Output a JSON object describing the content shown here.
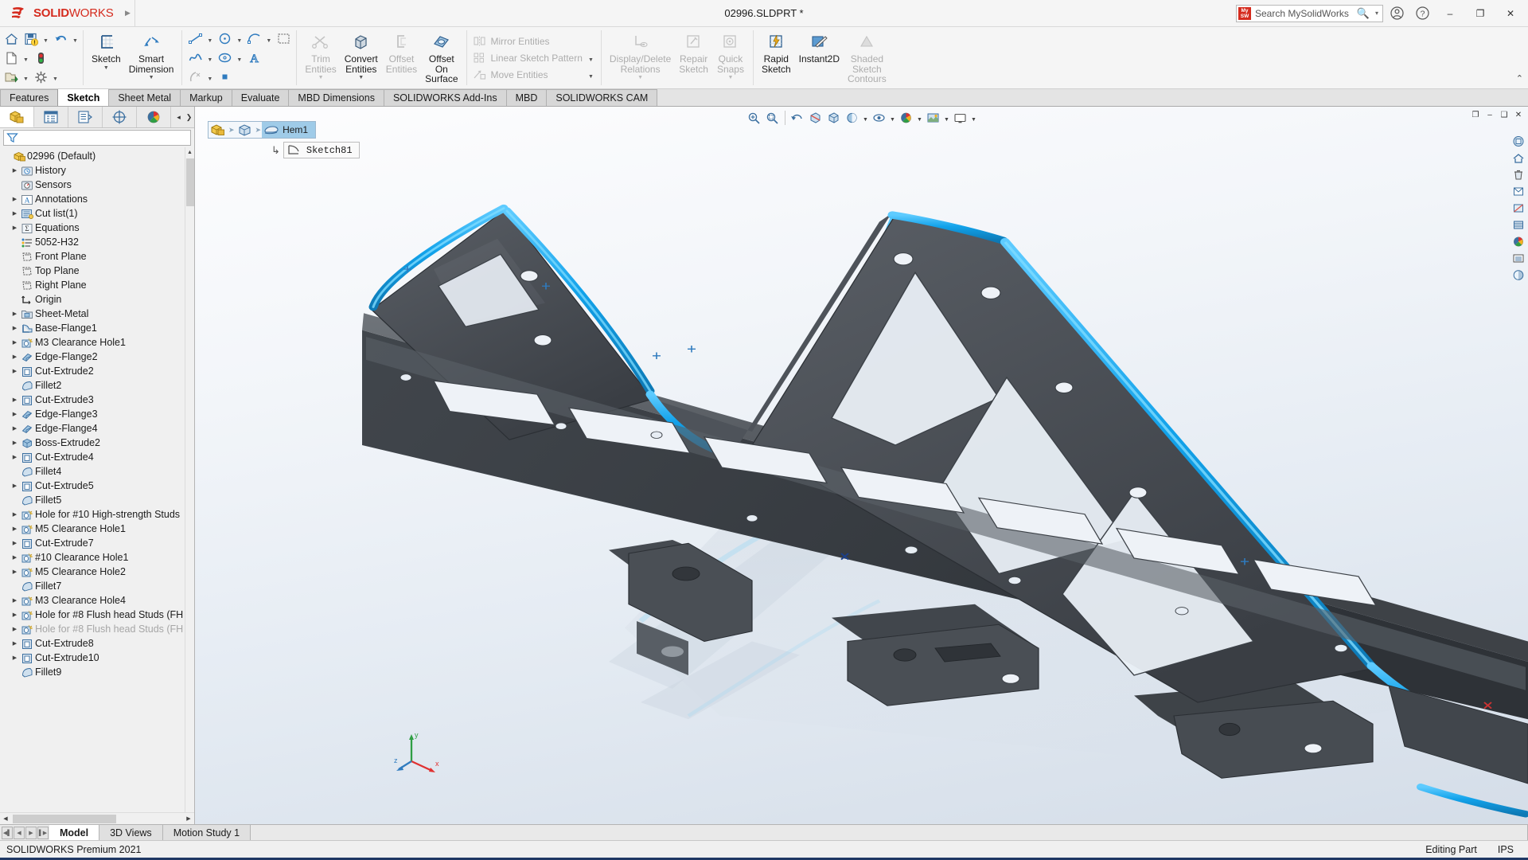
{
  "app": {
    "brand_bold": "SOLID",
    "brand_light": "WORKS",
    "title": "02996.SLDPRT *",
    "status_left": "SOLIDWORKS Premium 2021",
    "status_editing": "Editing Part",
    "status_units": "IPS",
    "accent_red": "#d52b1e",
    "accent_blue": "#2f7bbf",
    "highlight_cyan": "#1ba4e8"
  },
  "search": {
    "placeholder": "Search MySolidWorks",
    "icon": "search-icon",
    "badge_top": "My",
    "badge_bottom": "SW",
    "caret": "▾"
  },
  "titlebar_buttons": {
    "account": "account-icon",
    "help": "help-icon",
    "minimize": "–",
    "restore": "❐",
    "close": "✕"
  },
  "quick_access": {
    "home": "home-icon",
    "save": "save-icon",
    "undo": "undo-icon",
    "new": "new-document-icon",
    "rebuild": "rebuild-traffic-light-icon",
    "open": "open-folder-icon",
    "options": "options-gear-icon"
  },
  "ribbon": {
    "groups": [
      {
        "name": "sketch-group",
        "big": [
          {
            "label": "Sketch",
            "icon": "sketch-icon",
            "enabled": true,
            "caret": true
          },
          {
            "label": "Smart\nDimension",
            "icon": "smart-dimension-icon",
            "enabled": true,
            "caret": true
          }
        ]
      },
      {
        "name": "entities-group",
        "small_rows": [
          [
            "line-icon",
            "circle-icon",
            "arc-icon",
            "rectangle-grid-icon"
          ],
          [
            "spline-icon",
            "ellipse-icon",
            "text-icon"
          ],
          [
            "arc3pt-icon",
            "point-icon"
          ]
        ]
      },
      {
        "name": "tools-group",
        "big": [
          {
            "label": "Trim\nEntities",
            "icon": "trim-entities-icon",
            "enabled": false,
            "caret": true
          },
          {
            "label": "Convert\nEntities",
            "icon": "convert-entities-icon",
            "enabled": true,
            "caret": true
          },
          {
            "label": "Offset\nEntities",
            "icon": "offset-entities-icon",
            "enabled": false,
            "caret": false
          },
          {
            "label": "Offset\nOn\nSurface",
            "icon": "offset-on-surface-icon",
            "enabled": true,
            "caret": false
          }
        ]
      },
      {
        "name": "pattern-group",
        "stacked": [
          {
            "label": "Mirror Entities",
            "icon": "mirror-entities-icon",
            "enabled": false,
            "caret": false
          },
          {
            "label": "Linear Sketch Pattern",
            "icon": "linear-sketch-pattern-icon",
            "enabled": false,
            "caret": true
          },
          {
            "label": "Move Entities",
            "icon": "move-entities-icon",
            "enabled": false,
            "caret": true
          }
        ]
      },
      {
        "name": "relations-group",
        "big": [
          {
            "label": "Display/Delete\nRelations",
            "icon": "display-delete-relations-icon",
            "enabled": false,
            "caret": true
          },
          {
            "label": "Repair\nSketch",
            "icon": "repair-sketch-icon",
            "enabled": false,
            "caret": false
          },
          {
            "label": "Quick\nSnaps",
            "icon": "quick-snaps-icon",
            "enabled": false,
            "caret": true
          }
        ]
      },
      {
        "name": "modes-group",
        "big": [
          {
            "label": "Rapid\nSketch",
            "icon": "rapid-sketch-icon",
            "enabled": true,
            "caret": false
          },
          {
            "label": "Instant2D",
            "icon": "instant2d-icon",
            "enabled": true,
            "caret": false
          },
          {
            "label": "Shaded\nSketch\nContours",
            "icon": "shaded-sketch-contours-icon",
            "enabled": false,
            "caret": false
          }
        ]
      }
    ],
    "pin": "⌃"
  },
  "command_tabs": {
    "items": [
      {
        "label": "Features",
        "active": false
      },
      {
        "label": "Sketch",
        "active": true
      },
      {
        "label": "Sheet Metal",
        "active": false
      },
      {
        "label": "Markup",
        "active": false
      },
      {
        "label": "Evaluate",
        "active": false
      },
      {
        "label": "MBD Dimensions",
        "active": false
      },
      {
        "label": "SOLIDWORKS Add-Ins",
        "active": false
      },
      {
        "label": "MBD",
        "active": false
      },
      {
        "label": "SOLIDWORKS CAM",
        "active": false
      }
    ]
  },
  "feature_manager": {
    "tabs": [
      {
        "name": "feature-manager-tab",
        "icon": "feature-tree-icon",
        "active": true
      },
      {
        "name": "property-manager-tab",
        "icon": "property-manager-icon",
        "active": false
      },
      {
        "name": "configuration-manager-tab",
        "icon": "configuration-manager-icon",
        "active": false
      },
      {
        "name": "dimxpert-manager-tab",
        "icon": "dimxpert-icon",
        "active": false
      },
      {
        "name": "display-manager-tab",
        "icon": "display-manager-icon",
        "active": false
      }
    ],
    "filter_placeholder": "",
    "filter_icon": "filter-funnel-icon",
    "scroll_left": "◂",
    "scroll_right": "❯",
    "tree": [
      {
        "label": "02996  (Default)",
        "icon": "part-icon",
        "indent": 0,
        "expand": "none",
        "dim": false
      },
      {
        "label": "History",
        "icon": "history-icon",
        "indent": 1,
        "expand": "collapsed",
        "dim": false
      },
      {
        "label": "Sensors",
        "icon": "sensors-icon",
        "indent": 1,
        "expand": "none",
        "dim": false
      },
      {
        "label": "Annotations",
        "icon": "annotations-icon",
        "indent": 1,
        "expand": "collapsed",
        "dim": false
      },
      {
        "label": "Cut list(1)",
        "icon": "cutlist-icon",
        "indent": 1,
        "expand": "collapsed",
        "dim": false
      },
      {
        "label": "Equations",
        "icon": "equations-icon",
        "indent": 1,
        "expand": "collapsed",
        "dim": false
      },
      {
        "label": "5052-H32",
        "icon": "material-icon",
        "indent": 1,
        "expand": "none",
        "dim": false
      },
      {
        "label": "Front Plane",
        "icon": "plane-icon",
        "indent": 1,
        "expand": "none",
        "dim": false
      },
      {
        "label": "Top Plane",
        "icon": "plane-icon",
        "indent": 1,
        "expand": "none",
        "dim": false
      },
      {
        "label": "Right Plane",
        "icon": "plane-icon",
        "indent": 1,
        "expand": "none",
        "dim": false
      },
      {
        "label": "Origin",
        "icon": "origin-icon",
        "indent": 1,
        "expand": "none",
        "dim": false
      },
      {
        "label": "Sheet-Metal",
        "icon": "sheetmetal-folder-icon",
        "indent": 1,
        "expand": "collapsed",
        "dim": false
      },
      {
        "label": "Base-Flange1",
        "icon": "base-flange-icon",
        "indent": 1,
        "expand": "collapsed",
        "dim": false
      },
      {
        "label": "M3 Clearance Hole1",
        "icon": "hole-wizard-icon",
        "indent": 1,
        "expand": "collapsed",
        "dim": false
      },
      {
        "label": "Edge-Flange2",
        "icon": "edge-flange-icon",
        "indent": 1,
        "expand": "collapsed",
        "dim": false
      },
      {
        "label": "Cut-Extrude2",
        "icon": "cut-extrude-icon",
        "indent": 1,
        "expand": "collapsed",
        "dim": false
      },
      {
        "label": "Fillet2",
        "icon": "fillet-icon",
        "indent": 1,
        "expand": "none",
        "dim": false
      },
      {
        "label": "Cut-Extrude3",
        "icon": "cut-extrude-icon",
        "indent": 1,
        "expand": "collapsed",
        "dim": false
      },
      {
        "label": "Edge-Flange3",
        "icon": "edge-flange-icon",
        "indent": 1,
        "expand": "collapsed",
        "dim": false
      },
      {
        "label": "Edge-Flange4",
        "icon": "edge-flange-icon",
        "indent": 1,
        "expand": "collapsed",
        "dim": false
      },
      {
        "label": "Boss-Extrude2",
        "icon": "boss-extrude-icon",
        "indent": 1,
        "expand": "collapsed",
        "dim": false
      },
      {
        "label": "Cut-Extrude4",
        "icon": "cut-extrude-icon",
        "indent": 1,
        "expand": "collapsed",
        "dim": false
      },
      {
        "label": "Fillet4",
        "icon": "fillet-icon",
        "indent": 1,
        "expand": "none",
        "dim": false
      },
      {
        "label": "Cut-Extrude5",
        "icon": "cut-extrude-icon",
        "indent": 1,
        "expand": "collapsed",
        "dim": false
      },
      {
        "label": "Fillet5",
        "icon": "fillet-icon",
        "indent": 1,
        "expand": "none",
        "dim": false
      },
      {
        "label": "Hole for #10 High-strength Studs",
        "icon": "hole-wizard-icon",
        "indent": 1,
        "expand": "collapsed",
        "dim": false
      },
      {
        "label": "M5 Clearance Hole1",
        "icon": "hole-wizard-icon",
        "indent": 1,
        "expand": "collapsed",
        "dim": false
      },
      {
        "label": "Cut-Extrude7",
        "icon": "cut-extrude-icon",
        "indent": 1,
        "expand": "collapsed",
        "dim": false
      },
      {
        "label": "#10 Clearance Hole1",
        "icon": "hole-wizard-icon",
        "indent": 1,
        "expand": "collapsed",
        "dim": false
      },
      {
        "label": "M5 Clearance Hole2",
        "icon": "hole-wizard-icon",
        "indent": 1,
        "expand": "collapsed",
        "dim": false
      },
      {
        "label": "Fillet7",
        "icon": "fillet-icon",
        "indent": 1,
        "expand": "none",
        "dim": false
      },
      {
        "label": "M3 Clearance Hole4",
        "icon": "hole-wizard-icon",
        "indent": 1,
        "expand": "collapsed",
        "dim": false
      },
      {
        "label": "Hole for #8 Flush head Studs (FH",
        "icon": "hole-wizard-icon",
        "indent": 1,
        "expand": "collapsed",
        "dim": false
      },
      {
        "label": "Hole for #8 Flush head Studs (FH",
        "icon": "hole-wizard-icon",
        "indent": 1,
        "expand": "collapsed",
        "dim": true
      },
      {
        "label": "Cut-Extrude8",
        "icon": "cut-extrude-icon",
        "indent": 1,
        "expand": "collapsed",
        "dim": false
      },
      {
        "label": "Cut-Extrude10",
        "icon": "cut-extrude-icon",
        "indent": 1,
        "expand": "collapsed",
        "dim": false
      },
      {
        "label": "Fillet9",
        "icon": "fillet-icon",
        "indent": 1,
        "expand": "none",
        "dim": false
      }
    ]
  },
  "viewport": {
    "toolbar": [
      {
        "name": "zoom-to-fit-icon",
        "caret": false
      },
      {
        "name": "zoom-area-icon",
        "caret": false
      },
      {
        "name": "previous-view-icon",
        "caret": false
      },
      {
        "name": "section-view-icon",
        "caret": false
      },
      {
        "name": "view-orientation-icon",
        "caret": false
      },
      {
        "name": "display-style-icon",
        "caret": true
      },
      {
        "name": "hide-show-items-icon",
        "caret": true
      },
      {
        "name": "edit-appearance-icon",
        "caret": true
      },
      {
        "name": "apply-scene-icon",
        "caret": true
      },
      {
        "name": "view-settings-icon",
        "caret": true
      }
    ],
    "window_buttons": {
      "restore_small": "❐",
      "minimize": "–",
      "maximize": "❑",
      "close": "✕"
    },
    "breadcrumb": {
      "part_icon": "part-icon",
      "body_icon": "solid-body-icon",
      "feature_icon": "hem-icon",
      "feature_label": "Hem1",
      "child_arrow": "↳",
      "child_icon": "sketch-contour-icon",
      "child_label": "Sketch81"
    },
    "right_tools": [
      "view-selector-icon",
      "home-view-icon",
      "delete-view-icon",
      "prev-view-icon",
      "section-icon",
      "display-style-2-icon",
      "appearance-sphere-icon",
      "scene-icon",
      "view-settings-2-icon"
    ],
    "triad": {
      "x": "x",
      "y": "y",
      "z": "z"
    }
  },
  "bottom_tabs": {
    "nav": [
      "▌◀",
      "◀",
      "▶",
      "▶▐"
    ],
    "items": [
      {
        "label": "Model",
        "active": true
      },
      {
        "label": "3D Views",
        "active": false
      },
      {
        "label": "Motion Study 1",
        "active": false
      }
    ]
  }
}
